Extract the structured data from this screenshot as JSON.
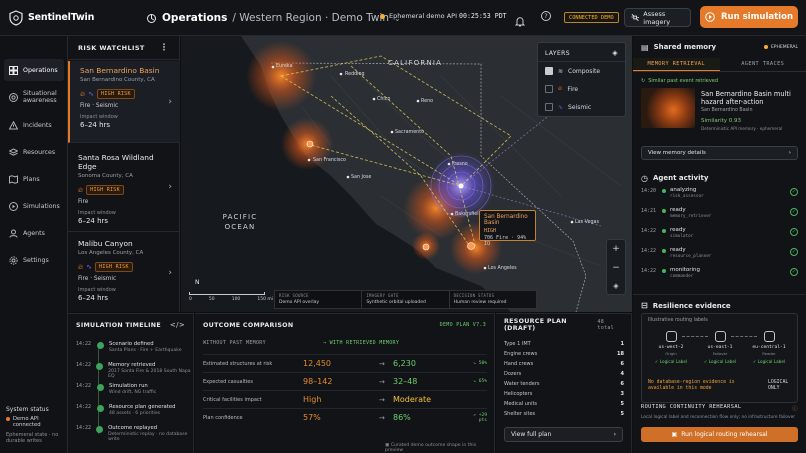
{
  "app": {
    "name": "SentinelTwin"
  },
  "header": {
    "title": "Operations",
    "path": "/ Western Region · Demo Twin",
    "api_status": "Ephemeral demo API",
    "clock": "00:25:53 PDT",
    "connection": "CONNECTED DEMO",
    "assess_label": "Assess imagery",
    "run_label": "Run simulation"
  },
  "nav": {
    "items": [
      {
        "label": "Operations",
        "icon": "grid-icon"
      },
      {
        "label": "Situational awareness",
        "icon": "radar-icon"
      },
      {
        "label": "Incidents",
        "icon": "alert-icon"
      },
      {
        "label": "Resources",
        "icon": "stack-icon"
      },
      {
        "label": "Plans",
        "icon": "map-icon"
      },
      {
        "label": "Simulations",
        "icon": "simulation-icon"
      },
      {
        "label": "Agents",
        "icon": "agents-icon"
      },
      {
        "label": "Settings",
        "icon": "gear-icon"
      }
    ],
    "system_status": {
      "title": "System status",
      "line1": "Demo API connected",
      "line2": "Ephemeral state · no durable writes"
    }
  },
  "watchlist": {
    "title": "RISK WATCHLIST",
    "items": [
      {
        "name": "San Bernardino Basin",
        "location": "San Bernardino County, CA",
        "risk": "HIGH RISK",
        "hazard": "Fire · Seismic",
        "window_label": "Impact window",
        "window": "6–24 hrs"
      },
      {
        "name": "Santa Rosa Wildland Edge",
        "location": "Sonoma County, CA",
        "risk": "HIGH RISK",
        "hazard": "Fire",
        "window_label": "Impact window",
        "window": "6–24 hrs"
      },
      {
        "name": "Malibu Canyon",
        "location": "Los Angeles County, CA",
        "risk": "HIGH RISK",
        "hazard": "Fire · Seismic",
        "window_label": "Impact window",
        "window": "6–24 hrs"
      }
    ]
  },
  "map": {
    "region_labels": {
      "california": "CALIFORNIA",
      "ocean": "PACIFIC OCEAN"
    },
    "cities": [
      "Eureka",
      "Redding",
      "Chico",
      "Reno",
      "Sacramento",
      "San Francisco",
      "San Jose",
      "Fresno",
      "Bakersfield",
      "Los Angeles",
      "Las Vegas"
    ],
    "layers": {
      "title": "LAYERS",
      "items": [
        {
          "label": "Composite",
          "checked": true
        },
        {
          "label": "Fire",
          "checked": false
        },
        {
          "label": "Seismic",
          "checked": false
        }
      ]
    },
    "callout": {
      "title": "San Bernardino Basin",
      "level": "HIGH",
      "detail": "706 Fire · 94% IQ"
    },
    "scale": {
      "north": "N",
      "ticks": [
        "0",
        "50",
        "100",
        "150 mi"
      ]
    },
    "footer": [
      {
        "key": "RISK SOURCE",
        "value": "Demo API overlay"
      },
      {
        "key": "IMAGERY GATE",
        "value": "Synthetic orbital uploaded"
      },
      {
        "key": "DECISION STATUS",
        "value": "Human review required"
      }
    ],
    "colors": {
      "fire": "#e8741f",
      "seismic": "#7a64f0",
      "route": "#e7d25a"
    }
  },
  "timeline": {
    "title": "SIMULATION TIMELINE",
    "items": [
      {
        "time": "14:22",
        "title": "Scenario defined",
        "sub": "Santa Plans · Fire + Earthquake"
      },
      {
        "time": "14:22",
        "title": "Memory retrieved",
        "sub": "2017 Santa Fire & 2018 South Napa EQ"
      },
      {
        "time": "14:22",
        "title": "Simulation run",
        "sub": "Wind drift, NG traffic"
      },
      {
        "time": "14:22",
        "title": "Resource plan generated",
        "sub": "48 assets · 6 priorities"
      },
      {
        "time": "14:22",
        "title": "Outcome replayed",
        "sub": "Deterministic replay · no database write"
      }
    ]
  },
  "outcome": {
    "title": "OUTCOME COMPARISON",
    "plan": "DEMO PLAN V7.3",
    "col_without": "WITHOUT PAST MEMORY",
    "col_with": "WITH RETRIEVED MEMORY",
    "rows": [
      {
        "label": "Estimated structures at risk",
        "before": "12,450",
        "after": "6,230",
        "delta": "↘ 50%"
      },
      {
        "label": "Expected casualties",
        "before": "98–142",
        "after": "32–48",
        "delta": "↘ 65%"
      },
      {
        "label": "Critical facilities impact",
        "before": "High",
        "after": "Moderate",
        "delta": ""
      },
      {
        "label": "Plan confidence",
        "before": "57%",
        "after": "86%",
        "delta": "↗ +29 pts"
      }
    ],
    "footnote": "Curated demo outcome shape in this preview"
  },
  "resource_plan": {
    "title": "RESOURCE PLAN (DRAFT)",
    "total": "48 total",
    "rows": [
      {
        "label": "Type 1 IMT",
        "value": "1"
      },
      {
        "label": "Engine crews",
        "value": "18"
      },
      {
        "label": "Hand crews",
        "value": "6"
      },
      {
        "label": "Dozers",
        "value": "4"
      },
      {
        "label": "Water tenders",
        "value": "6"
      },
      {
        "label": "Helicopters",
        "value": "3"
      },
      {
        "label": "Medical units",
        "value": "5"
      },
      {
        "label": "Shelter sites",
        "value": "5"
      }
    ],
    "view_label": "View full plan"
  },
  "shared_memory": {
    "title": "Shared memory",
    "mode": "EPHEMERAL",
    "tabs": [
      "MEMORY RETRIEVAL",
      "AGENT TRACES"
    ],
    "similar_label": "Similar past event retrieved",
    "event_title": "San Bernardino Basin multi hazard after-action",
    "event_loc": "San Bernardino Basin",
    "similarity": "Similarity 0.93",
    "event_meta": "Deterministic API memory · ephemeral",
    "details_label": "View memory details"
  },
  "agent_activity": {
    "title": "Agent activity",
    "items": [
      {
        "time": "14:20",
        "status": "analyzing",
        "agent": "risk_assessor"
      },
      {
        "time": "14:21",
        "status": "ready",
        "agent": "memory_retriever"
      },
      {
        "time": "14:22",
        "status": "ready",
        "agent": "simulator"
      },
      {
        "time": "14:22",
        "status": "ready",
        "agent": "resource_planner"
      },
      {
        "time": "14:22",
        "status": "monitoring",
        "agent": "commander"
      }
    ]
  },
  "resilience": {
    "title": "Resilience evidence",
    "caption": "Illustrative routing labels",
    "nodes": [
      {
        "name": "us-west-2",
        "role": "Origin",
        "tag": "✓ Logical Label"
      },
      {
        "name": "us-east-1",
        "role": "Failover",
        "tag": "✓ Logical Label"
      },
      {
        "name": "eu-central-1",
        "role": "Reader",
        "tag": "✓ Logical Label"
      }
    ],
    "warning": "No database-region evidence is available in this mode",
    "logical": "LOGICAL ONLY"
  },
  "rehearsal": {
    "title": "ROUTING CONTINUITY REHEARSAL",
    "desc": "Local logical label and reconnection flow only; no infrastructure failover",
    "button": "Run logical routing rehearsal"
  }
}
